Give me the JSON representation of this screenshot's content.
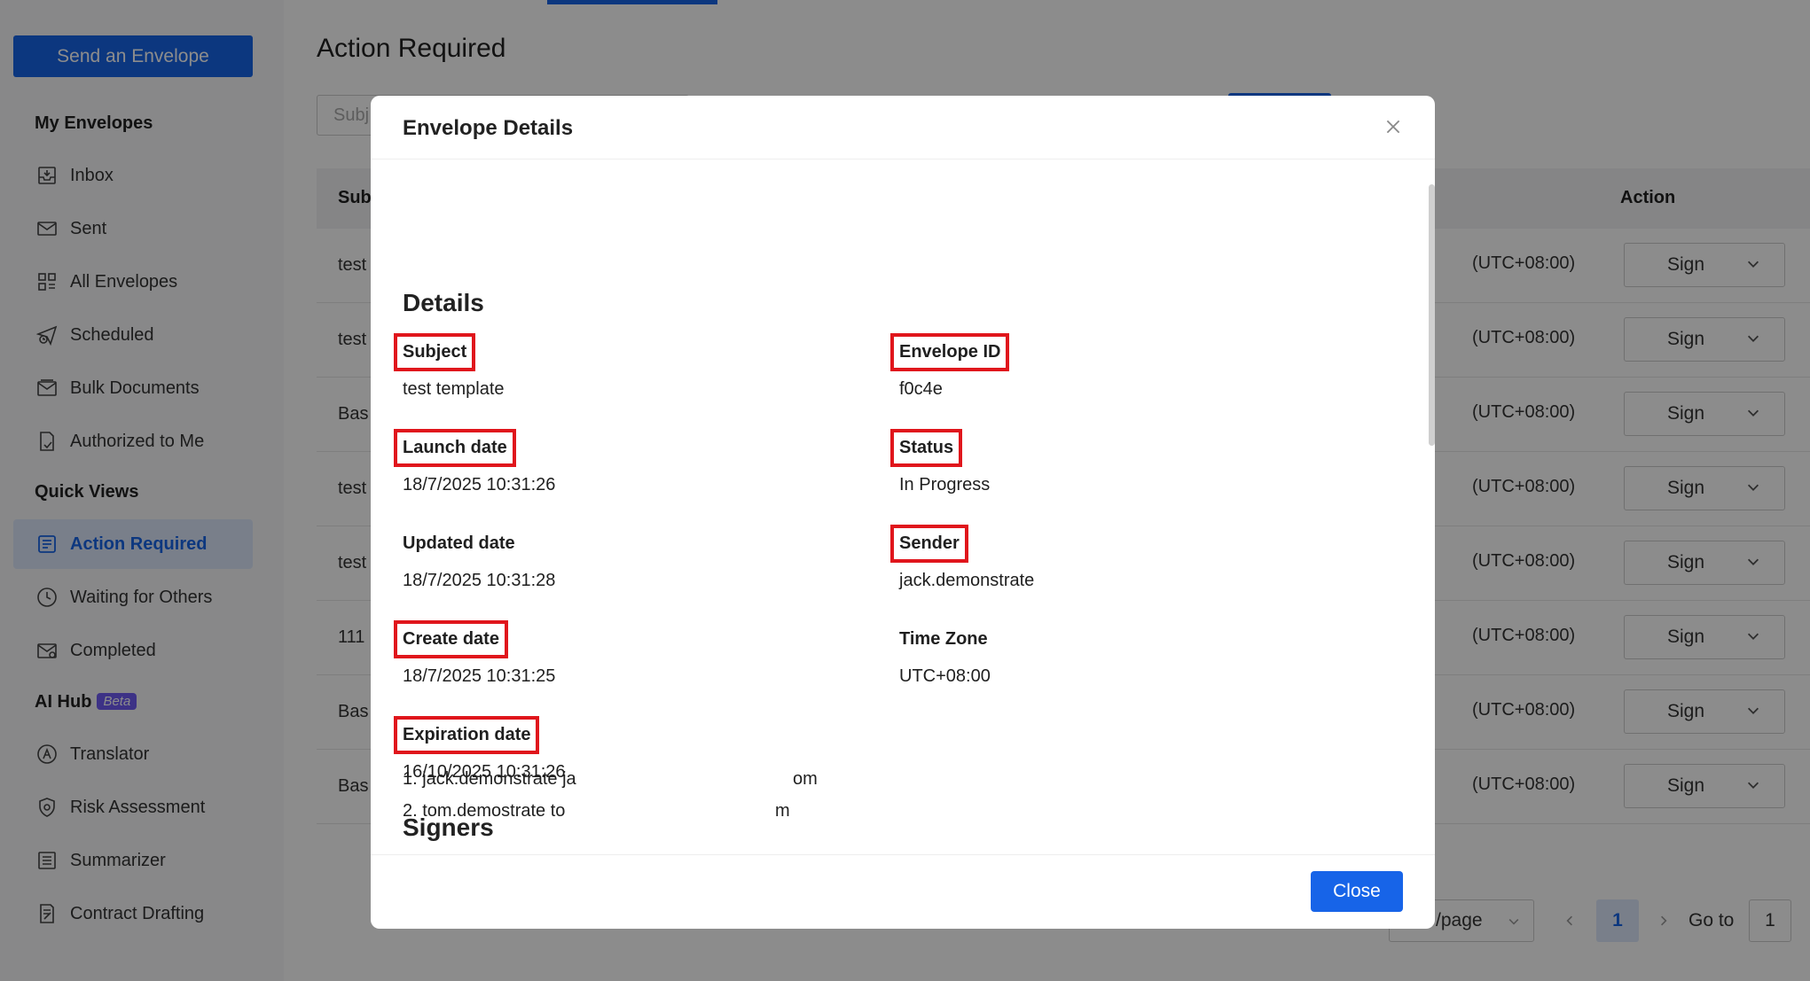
{
  "sidebar": {
    "send_button": "Send an Envelope",
    "sections": {
      "my_envelopes": "My Envelopes",
      "quick_views": "Quick Views",
      "ai_hub": "AI Hub",
      "ai_hub_badge": "Beta"
    },
    "items": [
      {
        "label": "Inbox",
        "icon": "inbox-icon"
      },
      {
        "label": "Sent",
        "icon": "sent-icon"
      },
      {
        "label": "All Envelopes",
        "icon": "grid-icon"
      },
      {
        "label": "Scheduled",
        "icon": "scheduled-icon"
      },
      {
        "label": "Bulk Documents",
        "icon": "bulk-documents-icon"
      },
      {
        "label": "Authorized to Me",
        "icon": "authorized-icon"
      },
      {
        "label": "Action Required",
        "icon": "action-required-icon",
        "active": true
      },
      {
        "label": "Waiting for Others",
        "icon": "clock-icon"
      },
      {
        "label": "Completed",
        "icon": "completed-icon"
      },
      {
        "label": "Translator",
        "icon": "translator-icon"
      },
      {
        "label": "Risk Assessment",
        "icon": "shield-icon"
      },
      {
        "label": "Summarizer",
        "icon": "summarizer-icon"
      },
      {
        "label": "Contract Drafting",
        "icon": "contract-drafting-icon"
      }
    ]
  },
  "main": {
    "title": "Action Required",
    "search_placeholder": "Subj",
    "table": {
      "col_subject": "Sub",
      "col_action": "Action",
      "rows": [
        {
          "subject": "test",
          "timezone": "(UTC+08:00)",
          "action": "Sign"
        },
        {
          "subject": "test",
          "timezone": "(UTC+08:00)",
          "action": "Sign"
        },
        {
          "subject": "Bas",
          "timezone": "(UTC+08:00)",
          "action": "Sign"
        },
        {
          "subject": "test",
          "timezone": "(UTC+08:00)",
          "action": "Sign"
        },
        {
          "subject": "test",
          "timezone": "(UTC+08:00)",
          "action": "Sign"
        },
        {
          "subject": "111",
          "timezone": "(UTC+08:00)",
          "action": "Sign"
        },
        {
          "subject": "Bas",
          "timezone": "(UTC+08:00)",
          "action": "Sign"
        },
        {
          "subject": "Bas",
          "timezone": "(UTC+08:00)",
          "action": "Sign"
        }
      ]
    },
    "pagination": {
      "page_size_label": "/page",
      "current_page": "1",
      "goto_label": "Go to",
      "goto_value": "1"
    }
  },
  "modal": {
    "title": "Envelope Details",
    "details_title": "Details",
    "fields": {
      "subject": {
        "label": "Subject",
        "value": "test template"
      },
      "envelope_id": {
        "label": "Envelope ID",
        "value": "f0c4e"
      },
      "launch_date": {
        "label": "Launch date",
        "value": "18/7/2025 10:31:26"
      },
      "status": {
        "label": "Status",
        "value": "In Progress"
      },
      "updated_date": {
        "label": "Updated date",
        "value": "18/7/2025 10:31:28"
      },
      "sender": {
        "label": "Sender",
        "value": "jack.demonstrate"
      },
      "create_date": {
        "label": "Create date",
        "value": "18/7/2025 10:31:25"
      },
      "time_zone": {
        "label": "Time Zone",
        "value": "UTC+08:00"
      },
      "expiration_date": {
        "label": "Expiration date",
        "value": "16/10/2025 10:31:26"
      }
    },
    "signers_title": "Signers",
    "signers": [
      {
        "text": "1. jack.demonstrate ja",
        "tail": "om"
      },
      {
        "text": "2. tom.demostrate to",
        "tail": "m"
      }
    ],
    "close_button": "Close"
  },
  "colors": {
    "primary": "#1764e8",
    "highlight": "#e0161c",
    "active_nav_bg": "#dde8fb",
    "beta_badge": "#6f5cf5"
  }
}
